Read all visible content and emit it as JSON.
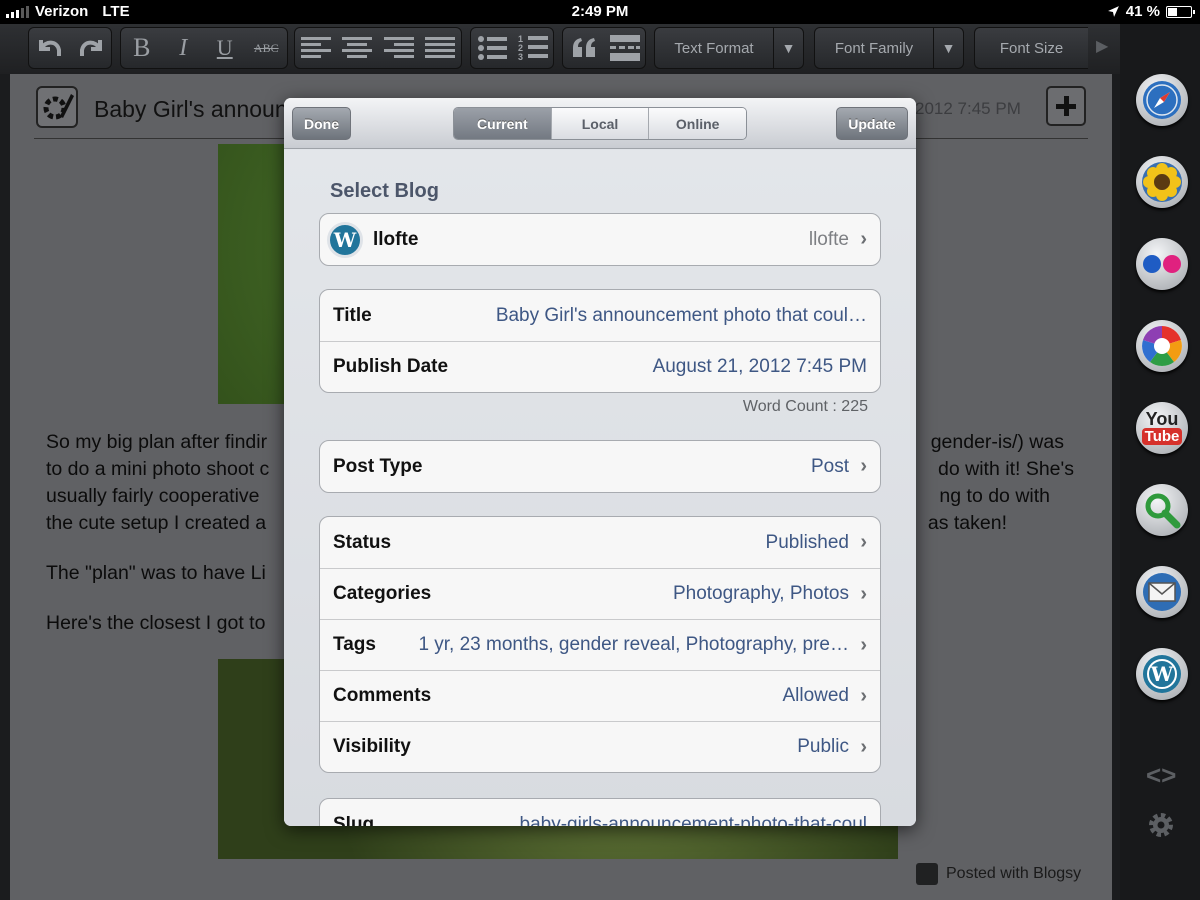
{
  "status_bar": {
    "carrier": "Verizon",
    "network": "LTE",
    "time": "2:49 PM",
    "battery": "41 %",
    "battery_level": 0.41
  },
  "toolbar": {
    "text_format": "Text Format",
    "font_family": "Font Family",
    "font_size": "Font Size",
    "strike_label": "ABC",
    "bold_label": "B",
    "italic_label": "I",
    "underline_label": "U"
  },
  "editor": {
    "title": "Baby Girl's announ",
    "date": "2012 7:45 PM",
    "paragraphs": [
      "So my big plan after findir",
      "to do a mini photo shoot c",
      "usually fairly cooperative",
      "the cute setup I created a"
    ],
    "paragraphs_right": [
      "gender-is/) was",
      "do with it! She's",
      "ng to do with",
      "as taken!"
    ],
    "line_plan": "The \"plan\" was to have Li",
    "line_closest": "Here's the closest I got to",
    "posted_with": "Posted with Blogsy"
  },
  "modal": {
    "done": "Done",
    "update": "Update",
    "segments": [
      "Current",
      "Local",
      "Online"
    ],
    "select_blog_label": "Select Blog",
    "blog": {
      "name": "llofte",
      "value": "llofte"
    },
    "title_row": {
      "label": "Title",
      "value": "Baby Girl's announcement photo that coul…"
    },
    "publish_row": {
      "label": "Publish Date",
      "value": "August 21, 2012 7:45 PM"
    },
    "word_count": "Word Count : 225",
    "post_type": {
      "label": "Post Type",
      "value": "Post"
    },
    "status": {
      "label": "Status",
      "value": "Published"
    },
    "categories": {
      "label": "Categories",
      "value": "Photography, Photos"
    },
    "tags": {
      "label": "Tags",
      "value": "1 yr, 23 months, gender reveal, Photography, pre…"
    },
    "comments": {
      "label": "Comments",
      "value": "Allowed"
    },
    "visibility": {
      "label": "Visibility",
      "value": "Public"
    },
    "slug": {
      "label": "Slug",
      "value": "baby-girls-announcement-photo-that-coul"
    }
  },
  "sidebar": {
    "icons": [
      "safari-icon",
      "sunflower-icon",
      "flickr-icon",
      "picasa-icon",
      "youtube-icon",
      "search-icon",
      "mail-icon",
      "wordpress-icon"
    ],
    "youtube_top": "You",
    "youtube_bottom": "Tube"
  }
}
